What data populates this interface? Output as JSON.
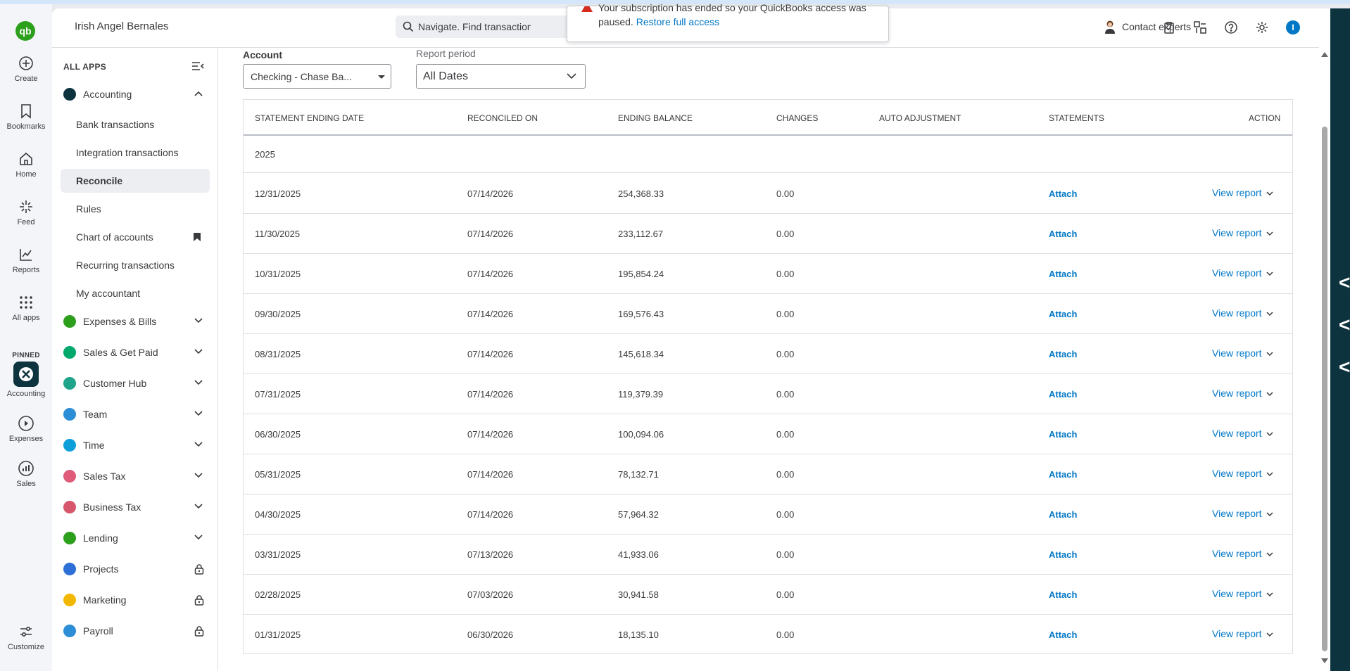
{
  "header": {
    "company_name": "Irish Angel Bernales",
    "search_placeholder": "Navigate. Find transactions",
    "notification_line1": "Your subscription has ended so your QuickBooks access was",
    "notification_line2": "paused.",
    "notification_link": "Restore full access",
    "contact_label": "Contact experts"
  },
  "rail": {
    "logo": "qb",
    "items": [
      {
        "label": "Create",
        "icon": "plus-circle-icon"
      },
      {
        "label": "Bookmarks",
        "icon": "bookmark-icon"
      },
      {
        "label": "Home",
        "icon": "home-icon"
      },
      {
        "label": "Feed",
        "icon": "sparkle-icon"
      },
      {
        "label": "Reports",
        "icon": "chart-icon"
      },
      {
        "label": "All apps",
        "icon": "grid-icon"
      }
    ],
    "pinned_label": "PINNED",
    "pinned": [
      {
        "label": "Accounting",
        "icon": "accounting-icon"
      },
      {
        "label": "Expenses",
        "icon": "expenses-icon"
      },
      {
        "label": "Sales",
        "icon": "sales-icon"
      }
    ],
    "customize_label": "Customize"
  },
  "nav": {
    "all_apps_label": "ALL APPS",
    "accounting": {
      "label": "Accounting",
      "subitems": [
        {
          "label": "Bank transactions"
        },
        {
          "label": "Integration transactions"
        },
        {
          "label": "Reconcile",
          "active": true
        },
        {
          "label": "Rules"
        },
        {
          "label": "Chart of accounts",
          "bookmarked": true
        },
        {
          "label": "Recurring transactions"
        },
        {
          "label": "My accountant"
        }
      ]
    },
    "sections": [
      {
        "label": "Expenses & Bills",
        "color": "#2ca01c",
        "locked": false
      },
      {
        "label": "Sales & Get Paid",
        "color": "#00a86b",
        "locked": false
      },
      {
        "label": "Customer Hub",
        "color": "#1fa38a",
        "locked": false
      },
      {
        "label": "Team",
        "color": "#2c8ed6",
        "locked": false
      },
      {
        "label": "Time",
        "color": "#0c9ed9",
        "locked": false
      },
      {
        "label": "Sales Tax",
        "color": "#e05a7a",
        "locked": false
      },
      {
        "label": "Business Tax",
        "color": "#d8566b",
        "locked": false
      },
      {
        "label": "Lending",
        "color": "#2ca01c",
        "locked": false
      },
      {
        "label": "Projects",
        "color": "#2c6fd6",
        "locked": true
      },
      {
        "label": "Marketing",
        "color": "#f2b800",
        "locked": true
      },
      {
        "label": "Payroll",
        "color": "#2c8ed6",
        "locked": true
      }
    ]
  },
  "filters": {
    "account_label": "Account",
    "account_value": "Checking - Chase Ba...",
    "period_label": "Report period",
    "period_value": "All Dates"
  },
  "table": {
    "headers": [
      "STATEMENT ENDING DATE",
      "RECONCILED ON",
      "ENDING BALANCE",
      "CHANGES",
      "AUTO ADJUSTMENT",
      "STATEMENTS",
      "ACTION"
    ],
    "group": "2025",
    "attach_label": "Attach",
    "view_label": "View report",
    "rows": [
      {
        "ending_date": "12/31/2025",
        "reconciled_on": "07/14/2026",
        "balance": "254,368.33",
        "changes": "0.00"
      },
      {
        "ending_date": "11/30/2025",
        "reconciled_on": "07/14/2026",
        "balance": "233,112.67",
        "changes": "0.00"
      },
      {
        "ending_date": "10/31/2025",
        "reconciled_on": "07/14/2026",
        "balance": "195,854.24",
        "changes": "0.00"
      },
      {
        "ending_date": "09/30/2025",
        "reconciled_on": "07/14/2026",
        "balance": "169,576.43",
        "changes": "0.00"
      },
      {
        "ending_date": "08/31/2025",
        "reconciled_on": "07/14/2026",
        "balance": "145,618.34",
        "changes": "0.00"
      },
      {
        "ending_date": "07/31/2025",
        "reconciled_on": "07/14/2026",
        "balance": "119,379.39",
        "changes": "0.00"
      },
      {
        "ending_date": "06/30/2025",
        "reconciled_on": "07/14/2026",
        "balance": "100,094.06",
        "changes": "0.00"
      },
      {
        "ending_date": "05/31/2025",
        "reconciled_on": "07/14/2026",
        "balance": "78,132.71",
        "changes": "0.00"
      },
      {
        "ending_date": "04/30/2025",
        "reconciled_on": "07/14/2026",
        "balance": "57,964.32",
        "changes": "0.00"
      },
      {
        "ending_date": "03/31/2025",
        "reconciled_on": "07/13/2026",
        "balance": "41,933.06",
        "changes": "0.00"
      },
      {
        "ending_date": "02/28/2025",
        "reconciled_on": "07/03/2026",
        "balance": "30,941.58",
        "changes": "0.00"
      },
      {
        "ending_date": "01/31/2025",
        "reconciled_on": "06/30/2026",
        "balance": "18,135.10",
        "changes": "0.00"
      }
    ]
  },
  "colors": {
    "brand_green": "#2ca01c",
    "link_blue": "#0077c5",
    "dark_panel": "#0d333f"
  }
}
